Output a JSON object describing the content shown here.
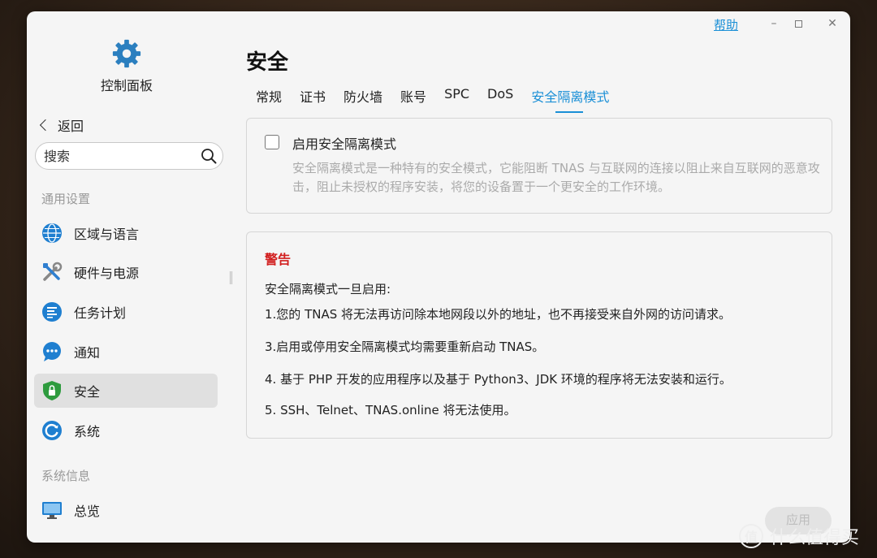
{
  "window": {
    "help_label": "帮助",
    "minimize_glyph": "–",
    "close_glyph": "✕"
  },
  "sidebar": {
    "app_title": "控制面板",
    "back_label": "返回",
    "search_placeholder": "搜索",
    "sections": [
      {
        "label": "通用设置",
        "items": [
          {
            "label": "区域与语言",
            "icon": "globe-icon"
          },
          {
            "label": "硬件与电源",
            "icon": "tools-icon"
          },
          {
            "label": "任务计划",
            "icon": "task-list-icon"
          },
          {
            "label": "通知",
            "icon": "chat-bubble-icon"
          },
          {
            "label": "安全",
            "icon": "shield-lock-icon",
            "active": true
          },
          {
            "label": "系统",
            "icon": "system-refresh-icon"
          }
        ]
      },
      {
        "label": "系统信息",
        "items": [
          {
            "label": "总览",
            "icon": "monitor-icon"
          }
        ]
      }
    ]
  },
  "main": {
    "title": "安全",
    "tabs": [
      {
        "label": "常规"
      },
      {
        "label": "证书"
      },
      {
        "label": "防火墙"
      },
      {
        "label": "账号"
      },
      {
        "label": "SPC"
      },
      {
        "label": "DoS"
      },
      {
        "label": "安全隔离模式",
        "active": true
      }
    ],
    "option": {
      "label": "启用安全隔离模式",
      "checked": false,
      "description": "安全隔离模式是一种特有的安全模式，它能阻断 TNAS 与互联网的连接以阻止来自互联网的恶意攻击，阻止未授权的程序安装，将您的设备置于一个更安全的工作环境。"
    },
    "warning": {
      "title": "警告",
      "intro": "安全隔离模式一旦启用:",
      "lines": [
        "1.您的 TNAS 将无法再访问除本地网段以外的地址，也不再接受来自外网的访问请求。",
        "3.启用或停用安全隔离模式均需要重新启动 TNAS。",
        "4. 基于 PHP 开发的应用程序以及基于 Python3、JDK 环境的程序将无法安装和运行。",
        "5. SSH、Telnet、TNAS.online 将无法使用。"
      ]
    },
    "apply_label": "应用"
  },
  "watermark": {
    "logo_text": "值",
    "text": "什么值得买"
  },
  "colors": {
    "accent": "#1a8fd6",
    "warning": "#d21f1f",
    "active_nav_bg": "#e0e0e0"
  }
}
